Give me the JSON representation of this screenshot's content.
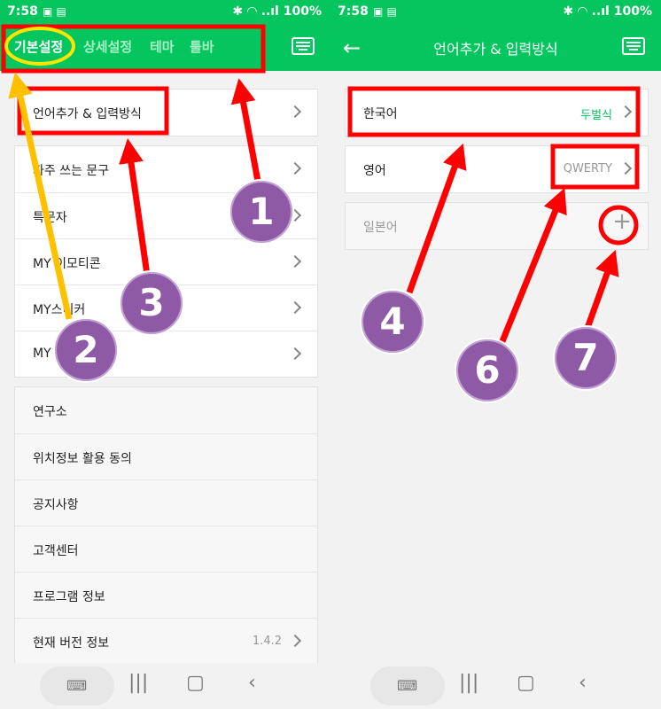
{
  "left": {
    "status": {
      "time": "7:58",
      "battery": "100%"
    },
    "tabs": [
      "기본설정",
      "상세설정",
      "테마",
      "툴바"
    ],
    "menu1": {
      "label": "언어추가 & 입력방식"
    },
    "menu2": [
      {
        "label": "자주 쓰는 문구"
      },
      {
        "label": "특문자"
      },
      {
        "label": "MY 이모티콘"
      },
      {
        "label": "MY스티커"
      },
      {
        "label": "MY"
      }
    ],
    "menu3": [
      {
        "label": "연구소"
      },
      {
        "label": "위치정보 활용 동의"
      },
      {
        "label": "공지사항"
      },
      {
        "label": "고객센터"
      },
      {
        "label": "프로그램 정보"
      },
      {
        "label": "현재 버전 정보",
        "value": "1.4.2"
      }
    ]
  },
  "right": {
    "status": {
      "time": "7:58",
      "battery": "100%"
    },
    "title": "언어추가 & 입력방식",
    "languages": [
      {
        "label": "한국어",
        "value": "두벌식",
        "value_color": "#05c65e"
      },
      {
        "label": "영어",
        "value": "QWERTY",
        "value_color": "#999999"
      },
      {
        "label": "일본어",
        "value": "+"
      }
    ]
  },
  "annotations": {
    "n1": "1",
    "n2": "2",
    "n3": "3",
    "n4": "4",
    "n6": "6",
    "n7": "7"
  },
  "colors": {
    "green": "#05c65e",
    "red": "#ff0000",
    "yellow": "#ffc000",
    "purple": "#8e5aa6"
  }
}
